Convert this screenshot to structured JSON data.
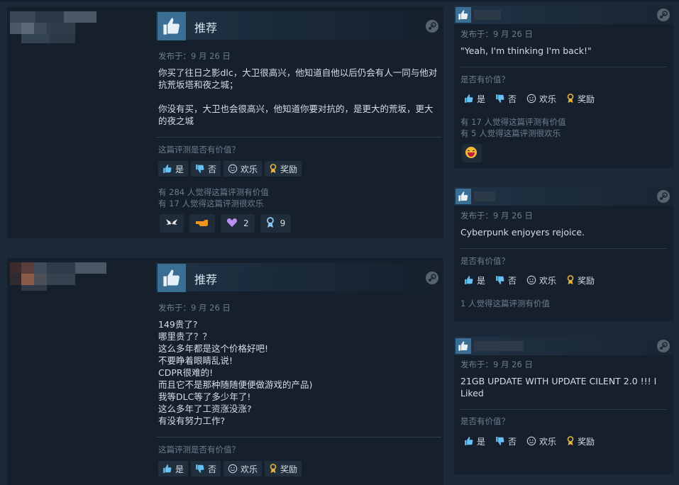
{
  "colors": {
    "page_bg": "#1b2838",
    "card_bg": "#16202d",
    "thumb_bg": "#3a6e94",
    "muted": "#6e7d8c",
    "text": "#d4dde6"
  },
  "reviews_main": [
    {
      "title": "推荐",
      "posted": "发布于：9 月 26 日",
      "body": "你买了往日之影dlc，大卫很高兴，他知道自他以后仍会有人一同与他对抗荒坂塔和夜之城；\n\n你没有买，大卫也会很高兴，他知道你要对抗的，是更大的荒坂，更大的夜之城",
      "helpful_question": "这篇评测是否有价值？",
      "buttons": {
        "yes": "是",
        "no": "否",
        "funny": "欢乐",
        "award": "奖励"
      },
      "stats": [
        "有 284 人觉得这篇评测有价值",
        "有 17 人觉得这篇评测很欢乐"
      ],
      "awards": [
        {
          "icon": "wings-icon",
          "count": ""
        },
        {
          "icon": "pointing-hand-icon",
          "count": ""
        },
        {
          "icon": "heart-hands-icon",
          "count": "2"
        },
        {
          "icon": "ribbon-icon",
          "count": "9"
        }
      ]
    },
    {
      "title": "推荐",
      "posted": "发布于：9 月 26 日",
      "body": "149贵了?\n哪里贵了？？\n这么多年都是这个价格好吧!\n不要睁着眼睛乱说!\nCDPR很难的!\n而且它不是那种随随便便做游戏的产品)\n我等DLC等了多少年了!\n这么多年了工资涨没涨?\n有没有努力工作?",
      "helpful_question": "这篇评测是否有价值？",
      "buttons": {
        "yes": "是",
        "no": "否",
        "funny": "欢乐",
        "award": "奖励"
      }
    }
  ],
  "reviews_side": [
    {
      "posted": "发布于：9 月 26 日",
      "body": "\"Yeah, I'm thinking I'm back!\"",
      "helpful_question": "是否有价值？",
      "buttons": {
        "yes": "是",
        "no": "否",
        "funny": "欢乐",
        "award": "奖励"
      },
      "stats": [
        "有 17 人觉得这篇评测有价值",
        "有 5 人觉得这篇评测很欢乐"
      ],
      "awards": [
        {
          "icon": "laughing-face-icon",
          "count": ""
        }
      ]
    },
    {
      "posted": "发布于：9 月 26 日",
      "body": "Cyberpunk enjoyers rejoice.",
      "helpful_question": "是否有价值？",
      "buttons": {
        "yes": "是",
        "no": "否",
        "funny": "欢乐",
        "award": "奖励"
      },
      "stats": [
        "1 人觉得这篇评测有价值"
      ]
    },
    {
      "posted": "发布于：9 月 26 日",
      "body": "21GB UPDATE WITH UPDATE CILENT 2.0 !!! I Liked",
      "helpful_question": "是否有价值？",
      "buttons": {
        "yes": "是",
        "no": "否",
        "funny": "欢乐",
        "award": "奖励"
      }
    }
  ]
}
